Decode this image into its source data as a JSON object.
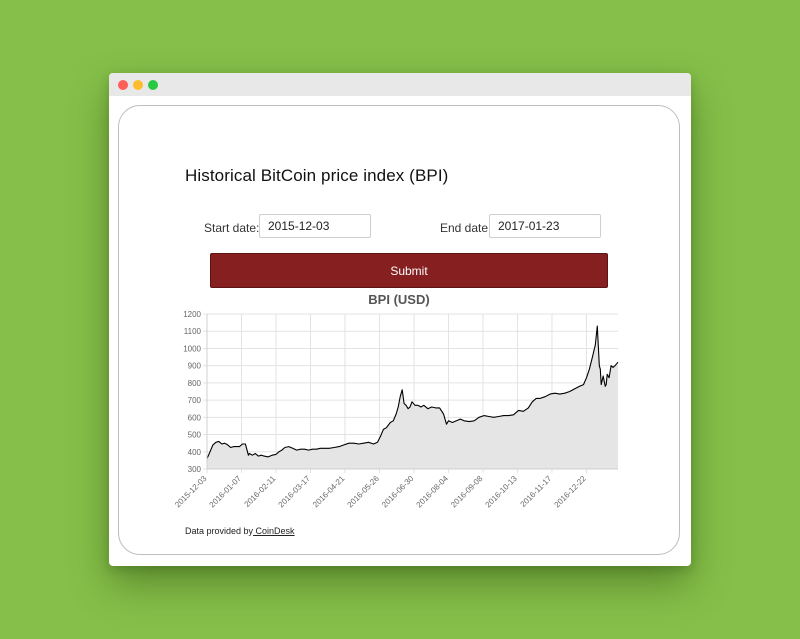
{
  "form": {
    "title": "Historical BitCoin price index (BPI)",
    "start_label": "Start date:",
    "start_value": "2015-12-03",
    "end_label": "End date:",
    "end_value": "2017-01-23",
    "submit_label": "Submit"
  },
  "footer": {
    "prefix": "Data provided by",
    "link_text": " CoinDesk"
  },
  "chart_data": {
    "type": "area",
    "title": "BPI (USD)",
    "xlabel": "",
    "ylabel": "",
    "ylim": [
      300,
      1200
    ],
    "y_ticks": [
      300,
      400,
      500,
      600,
      700,
      800,
      900,
      1000,
      1100,
      1200
    ],
    "x_ticks": [
      "2015-12-03",
      "2016-01-07",
      "2016-02-11",
      "2016-03-17",
      "2016-04-21",
      "2016-05-26",
      "2016-06-30",
      "2016-08-04",
      "2016-09-08",
      "2016-10-13",
      "2016-11-17",
      "2016-12-22"
    ],
    "grid": true,
    "line_color": "#000000",
    "fill_color": "#e5e5e5",
    "series": [
      {
        "x": [
          "2015-12-03",
          "2015-12-06",
          "2015-12-09",
          "2015-12-12",
          "2015-12-15",
          "2015-12-18",
          "2015-12-21",
          "2015-12-24",
          "2015-12-27",
          "2015-12-30",
          "2016-01-02",
          "2016-01-05",
          "2016-01-08",
          "2016-01-11",
          "2016-01-14",
          "2016-01-15",
          "2016-01-18",
          "2016-01-21",
          "2016-01-24",
          "2016-01-27",
          "2016-01-30",
          "2016-02-03",
          "2016-02-07",
          "2016-02-11",
          "2016-02-14",
          "2016-02-17",
          "2016-02-20",
          "2016-02-24",
          "2016-02-28",
          "2016-03-03",
          "2016-03-07",
          "2016-03-11",
          "2016-03-15",
          "2016-03-19",
          "2016-03-23",
          "2016-03-27",
          "2016-03-31",
          "2016-04-05",
          "2016-04-10",
          "2016-04-15",
          "2016-04-20",
          "2016-04-25",
          "2016-04-30",
          "2016-05-05",
          "2016-05-10",
          "2016-05-15",
          "2016-05-20",
          "2016-05-24",
          "2016-05-27",
          "2016-05-30",
          "2016-06-02",
          "2016-06-06",
          "2016-06-09",
          "2016-06-12",
          "2016-06-14",
          "2016-06-16",
          "2016-06-18",
          "2016-06-20",
          "2016-06-22",
          "2016-06-24",
          "2016-06-26",
          "2016-06-28",
          "2016-07-01",
          "2016-07-04",
          "2016-07-07",
          "2016-07-10",
          "2016-07-14",
          "2016-07-18",
          "2016-07-22",
          "2016-07-26",
          "2016-07-30",
          "2016-08-02",
          "2016-08-04",
          "2016-08-08",
          "2016-08-12",
          "2016-08-16",
          "2016-08-20",
          "2016-08-25",
          "2016-08-30",
          "2016-09-04",
          "2016-09-09",
          "2016-09-14",
          "2016-09-19",
          "2016-09-24",
          "2016-09-29",
          "2016-10-04",
          "2016-10-09",
          "2016-10-14",
          "2016-10-19",
          "2016-10-24",
          "2016-10-28",
          "2016-11-01",
          "2016-11-05",
          "2016-11-10",
          "2016-11-15",
          "2016-11-20",
          "2016-11-25",
          "2016-11-30",
          "2016-12-05",
          "2016-12-10",
          "2016-12-15",
          "2016-12-19",
          "2016-12-22",
          "2016-12-25",
          "2016-12-28",
          "2016-12-31",
          "2017-01-02",
          "2017-01-04",
          "2017-01-05",
          "2017-01-06",
          "2017-01-08",
          "2017-01-10",
          "2017-01-11",
          "2017-01-12",
          "2017-01-14",
          "2017-01-16",
          "2017-01-18",
          "2017-01-20",
          "2017-01-23"
        ],
        "values": [
          360,
          400,
          440,
          455,
          460,
          445,
          450,
          440,
          425,
          430,
          430,
          430,
          445,
          445,
          380,
          390,
          380,
          390,
          375,
          380,
          375,
          370,
          380,
          385,
          400,
          410,
          425,
          430,
          420,
          410,
          415,
          415,
          410,
          415,
          415,
          420,
          420,
          420,
          425,
          430,
          440,
          450,
          450,
          445,
          450,
          455,
          445,
          455,
          490,
          530,
          540,
          570,
          580,
          620,
          660,
          720,
          760,
          680,
          670,
          650,
          660,
          690,
          670,
          670,
          660,
          670,
          650,
          660,
          655,
          655,
          620,
          560,
          580,
          570,
          580,
          590,
          580,
          575,
          580,
          600,
          610,
          605,
          600,
          605,
          610,
          610,
          615,
          640,
          635,
          655,
          690,
          710,
          710,
          720,
          735,
          740,
          735,
          740,
          750,
          765,
          780,
          790,
          830,
          880,
          950,
          1020,
          1130,
          900,
          880,
          790,
          840,
          780,
          790,
          850,
          830,
          900,
          890,
          900,
          920
        ]
      }
    ]
  }
}
